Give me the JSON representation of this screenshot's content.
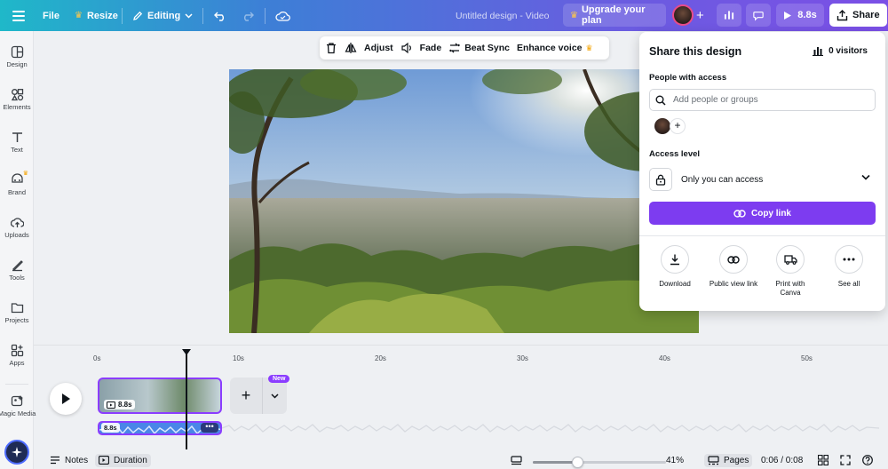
{
  "topbar": {
    "file": "File",
    "resize": "Resize",
    "editing": "Editing",
    "title": "Untitled design - Video",
    "upgrade": "Upgrade your plan",
    "play_duration": "8.8s",
    "share": "Share"
  },
  "sidebar": {
    "items": [
      {
        "label": "Design",
        "icon": "design-icon"
      },
      {
        "label": "Elements",
        "icon": "elements-icon"
      },
      {
        "label": "Text",
        "icon": "text-icon"
      },
      {
        "label": "Brand",
        "icon": "brand-icon"
      },
      {
        "label": "Uploads",
        "icon": "uploads-icon"
      },
      {
        "label": "Tools",
        "icon": "tools-icon"
      },
      {
        "label": "Projects",
        "icon": "projects-icon"
      },
      {
        "label": "Apps",
        "icon": "apps-icon"
      },
      {
        "label": "Magic Media",
        "icon": "magic-media-icon"
      }
    ]
  },
  "context_toolbar": {
    "adjust": "Adjust",
    "fade": "Fade",
    "beat_sync": "Beat Sync",
    "enhance_voice": "Enhance voice"
  },
  "share_panel": {
    "title": "Share this design",
    "visitors": "0 visitors",
    "people_label": "People with access",
    "search_placeholder": "Add people or groups",
    "access_label": "Access level",
    "access_value": "Only you can access",
    "copy_link": "Copy link",
    "options": [
      {
        "label": "Download",
        "icon": "download-icon"
      },
      {
        "label": "Public view link",
        "icon": "link-icon"
      },
      {
        "label": "Print with Canva",
        "icon": "truck-icon"
      },
      {
        "label": "See all",
        "icon": "more-icon"
      }
    ]
  },
  "timeline": {
    "ruler": [
      "0s",
      "10s",
      "20s",
      "30s",
      "40s",
      "50s"
    ],
    "clip_duration": "8.8s",
    "new_badge": "New",
    "audio_duration": "8.8s",
    "audio_more": "•••"
  },
  "bottombar": {
    "notes": "Notes",
    "duration": "Duration",
    "zoom": "41%",
    "pages": "Pages",
    "time": "0:06 / 0:08",
    "zoom_fraction": 0.33
  },
  "colors": {
    "accent": "#8b3dff",
    "copy_button": "#7d3cf0"
  }
}
